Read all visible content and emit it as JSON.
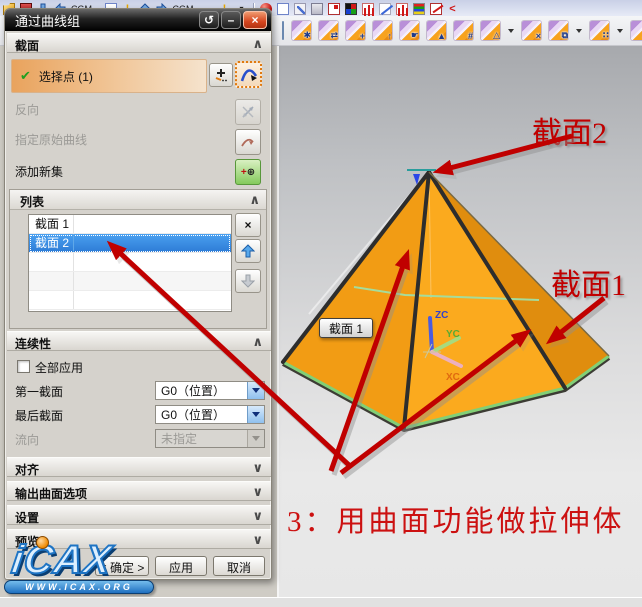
{
  "colors": {
    "pyramid_orange": "#f6a31a",
    "selection_blue": "#2e7cd6",
    "annotation_red": "#c00000",
    "edge_green": "#82cf76",
    "dialog_bg": "#d5d2cc"
  },
  "icons": {
    "reset": "↺",
    "minimize": "–",
    "close": "×",
    "check": "✔",
    "collapse": "∧",
    "expand": "∨",
    "remove": "×",
    "plus": "+",
    "target": "⊕",
    "warn": "!",
    "dropdown": "▾",
    "angle": "<",
    "ellipsis": "..."
  },
  "toolbar_top": {
    "cgm1": "CGM...",
    "cgm2": "CGM...",
    "tail": "...",
    "icon_names": [
      "folder-icon",
      "red-box-icon",
      "arrow-down-icon",
      "arrow-left-icon",
      "doc-icon",
      "warning-icon",
      "arrow-up-icon",
      "arrow-right-icon",
      "dropdown-icon",
      "sphere-icon",
      "page-icon",
      "pen-icon",
      "box-icon",
      "window-mark-icon",
      "palette-icon",
      "grid-plus-icon",
      "line-icon",
      "grid-plus2-icon",
      "rainbow-icon",
      "sketch-icon",
      "angle-icon"
    ]
  },
  "toolbar_features": {
    "icon_names": [
      "sync-modeling-icon",
      "edit-feature-wand-icon",
      "edit-feature-swap-icon",
      "edit-feature-position-icon",
      "edit-feature-move-icon",
      "edit-feature-hand-icon",
      "edit-feature-delay-icon",
      "edit-feature-group-icon",
      "edit-feature-triangle-icon",
      "suppress-feature-icon",
      "copy-feature-icon",
      "pattern-feature-icon",
      "feature-dimension-icon"
    ],
    "overlays": [
      "",
      "✱",
      "⇄",
      "+",
      "↑",
      "☛",
      "▲",
      "#",
      "△",
      "×",
      "⧉",
      "∷",
      "↔"
    ]
  },
  "dialog": {
    "title": "通过曲线组",
    "section_header": "截面",
    "select_point": "选择点 (1)",
    "reverse": "反向",
    "specify_curve": "指定原始曲线",
    "add_new_set": "添加新集",
    "list": {
      "header": "列表",
      "rows": [
        "截面 1",
        "截面 2"
      ],
      "selected_index": 1
    },
    "continuity": {
      "header": "连续性",
      "apply_all": "全部应用",
      "first_label": "第一截面",
      "first_value": "G0（位置）",
      "last_label": "最后截面",
      "last_value": "G0（位置）",
      "flow_label": "流向",
      "flow_value": "未指定"
    },
    "collapsed": [
      "对齐",
      "输出曲面选项",
      "设置",
      "预览"
    ],
    "footer": {
      "ok": "< 确定 >",
      "apply": "应用",
      "cancel": "取消"
    }
  },
  "viewport": {
    "label_section2": "截面2",
    "label_section1": "截面1",
    "tag": "截面 1",
    "note": "3：用曲面功能做拉伸体",
    "triad": {
      "zc": "ZC",
      "yc": "YC",
      "xc": "XC"
    }
  },
  "watermark": {
    "brand": "iCAX",
    "site": "WWW.ICAX.ORG"
  },
  "statusbar": {
    "text": ""
  }
}
